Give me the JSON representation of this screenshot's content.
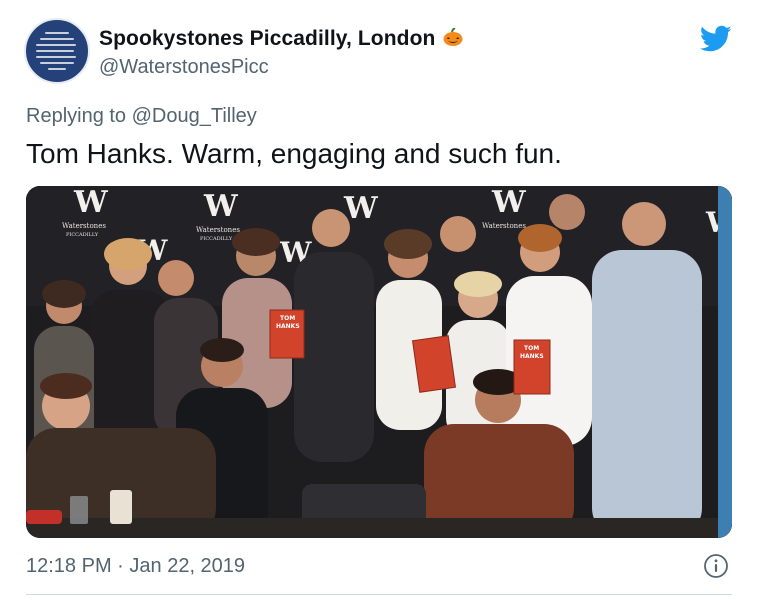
{
  "tweet": {
    "display_name": "Spookystones Piccadilly, London",
    "handle": "@WaterstonesPicc",
    "replying_prefix": "Replying to ",
    "replying_to": "@Doug_Tilley",
    "text": "Tom Hanks. Warm, engaging and such fun.",
    "time": "12:18 PM",
    "separator": " · ",
    "date": "Jan 22, 2019"
  },
  "icons": {
    "avatar": "waterstones-avatar",
    "name_emoji": "pumpkin-icon",
    "brand": "twitter-bird-icon",
    "info": "info-icon"
  },
  "photo": {
    "backdrop_letter": "W",
    "backdrop_brand": "Waterstones",
    "backdrop_store": "PICCADILLY",
    "book_title_1": "TOM",
    "book_title_2": "HANKS"
  },
  "colors": {
    "brand_blue": "#1d9bf0",
    "muted_text": "#536471",
    "primary_text": "#0f1419",
    "book_red": "#d2432c"
  }
}
